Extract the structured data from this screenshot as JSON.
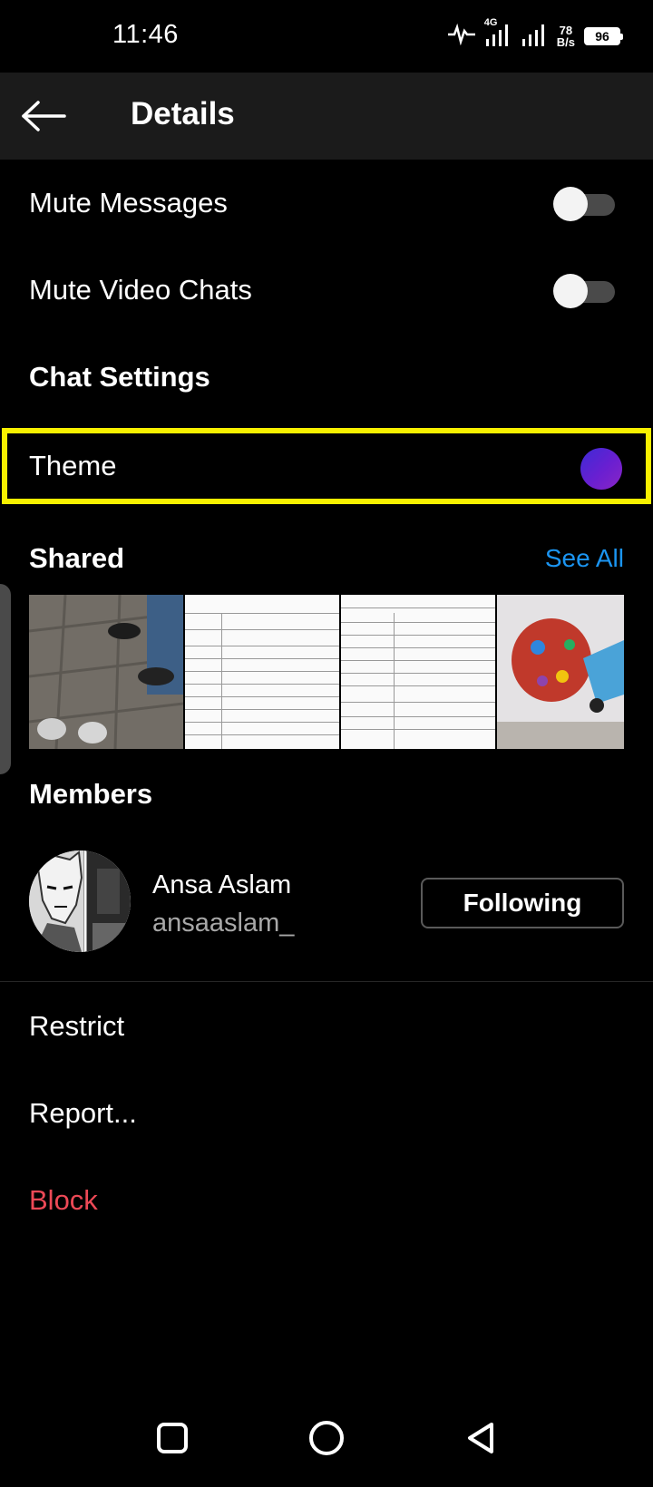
{
  "status_bar": {
    "time": "11:46",
    "network": "4G",
    "speed_value": "78",
    "speed_unit": "B/s",
    "battery": "96"
  },
  "header": {
    "back_icon": "arrow-left-icon",
    "title": "Details"
  },
  "settings": {
    "mute_messages": {
      "label": "Mute Messages",
      "on": false
    },
    "mute_video_chats": {
      "label": "Mute Video Chats",
      "on": false
    },
    "chat_settings_title": "Chat Settings",
    "theme": {
      "label": "Theme",
      "color_start": "#3d2bd6",
      "color_end": "#8a26c4"
    }
  },
  "shared": {
    "title": "Shared",
    "see_all": "See All",
    "accent": "#1b95f2",
    "items": [
      {
        "kind": "photo"
      },
      {
        "kind": "document"
      },
      {
        "kind": "document"
      },
      {
        "kind": "photo"
      }
    ]
  },
  "members": {
    "title": "Members",
    "list": [
      {
        "name": "Ansa Aslam",
        "username": "ansaaslam_",
        "button": "Following"
      }
    ]
  },
  "actions": {
    "restrict": "Restrict",
    "report": "Report...",
    "block": "Block",
    "block_color": "#ed4956"
  },
  "nav_bar": {
    "recents_icon": "square-icon",
    "home_icon": "circle-icon",
    "back_icon": "triangle-back-icon"
  }
}
